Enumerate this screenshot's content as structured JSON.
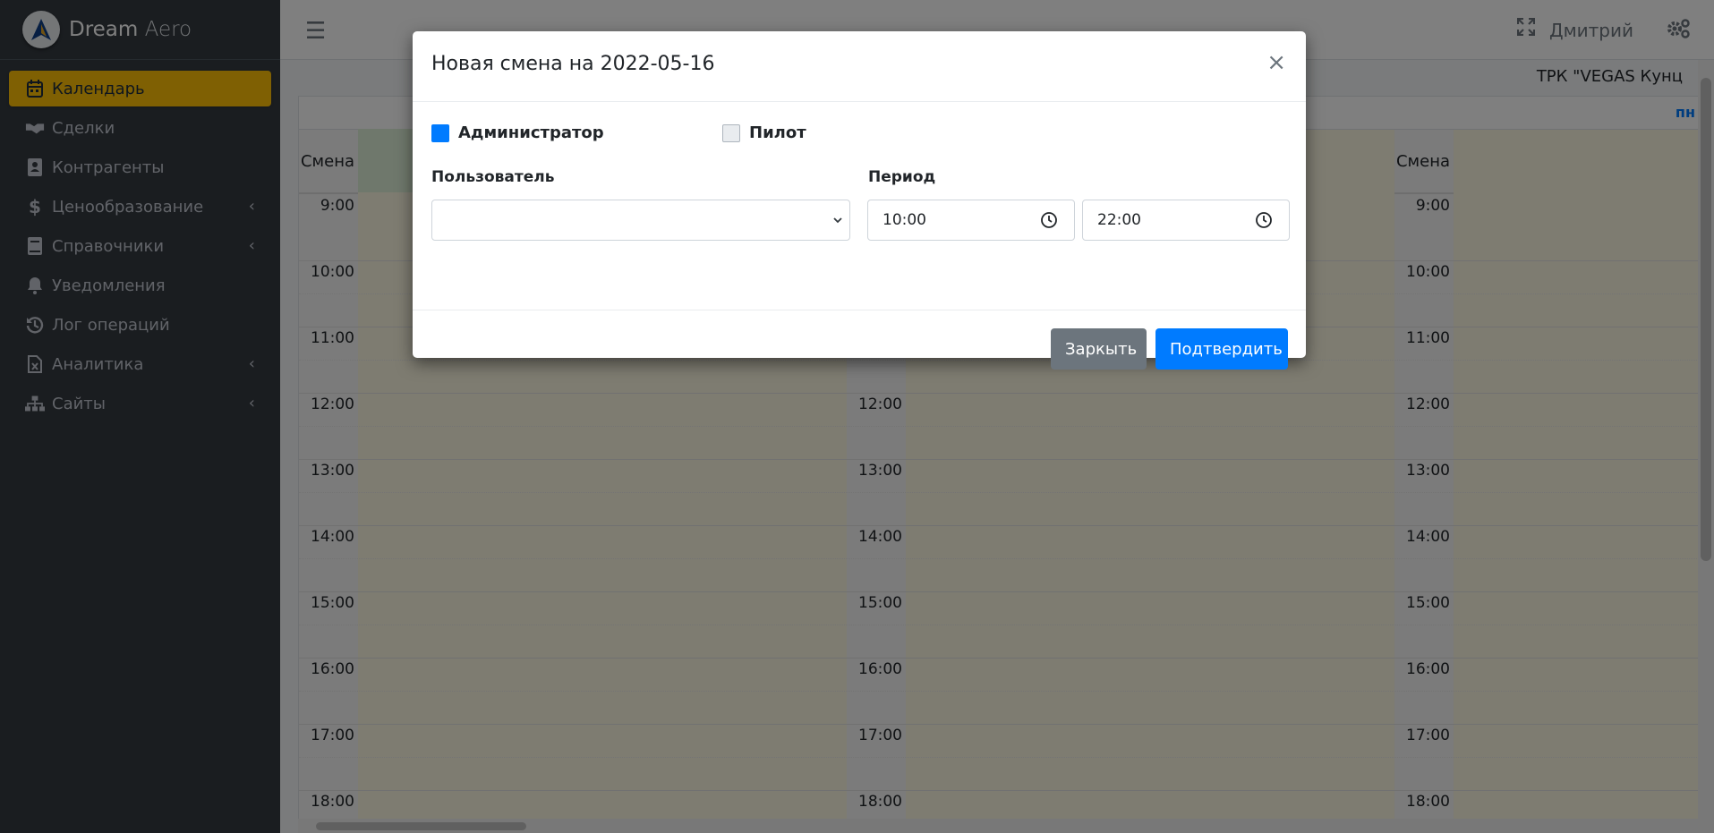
{
  "brand": {
    "name_main": "Dream",
    "name_light": " Aero"
  },
  "sidebar": {
    "items": [
      {
        "label": "Календарь",
        "icon": "calendar-icon",
        "active": true,
        "has_arrow": false
      },
      {
        "label": "Сделки",
        "icon": "handshake-icon",
        "has_arrow": false
      },
      {
        "label": "Контрагенты",
        "icon": "address-book-icon",
        "has_arrow": false
      },
      {
        "label": "Ценообразование",
        "icon": "dollar-icon",
        "has_arrow": true
      },
      {
        "label": "Справочники",
        "icon": "book-icon",
        "has_arrow": true
      },
      {
        "label": "Уведомления",
        "icon": "bell-icon",
        "has_arrow": false
      },
      {
        "label": "Лог операций",
        "icon": "history-icon",
        "has_arrow": false
      },
      {
        "label": "Аналитика",
        "icon": "excel-file-icon",
        "has_arrow": true
      },
      {
        "label": "Сайты",
        "icon": "sitemap-icon",
        "has_arrow": true
      }
    ]
  },
  "topbar": {
    "user_name": "Дмитрий"
  },
  "calendar": {
    "location": "ТРК \"VEGAS Кунц",
    "shift_label": "Смена",
    "day_header": "пн",
    "times": [
      "9:00",
      "10:00",
      "11:00",
      "12:00",
      "13:00",
      "14:00",
      "15:00",
      "16:00",
      "17:00",
      "18:00"
    ]
  },
  "modal": {
    "title": "Новая смена на 2022-05-16",
    "close_symbol": "×",
    "roles": [
      {
        "label": "Администратор",
        "checked": true
      },
      {
        "label": "Пилот",
        "checked": false
      }
    ],
    "user_label": "Пользователь",
    "user_value": "",
    "period_label": "Период",
    "period_start": "10:00",
    "period_end": "22:00",
    "cancel_label": "Заркыть",
    "confirm_label": "Подтвердить"
  },
  "colors": {
    "accent": "#ffc107",
    "primary": "#007bff",
    "sidebar_bg": "#343a40",
    "secondary": "#6c757d"
  }
}
